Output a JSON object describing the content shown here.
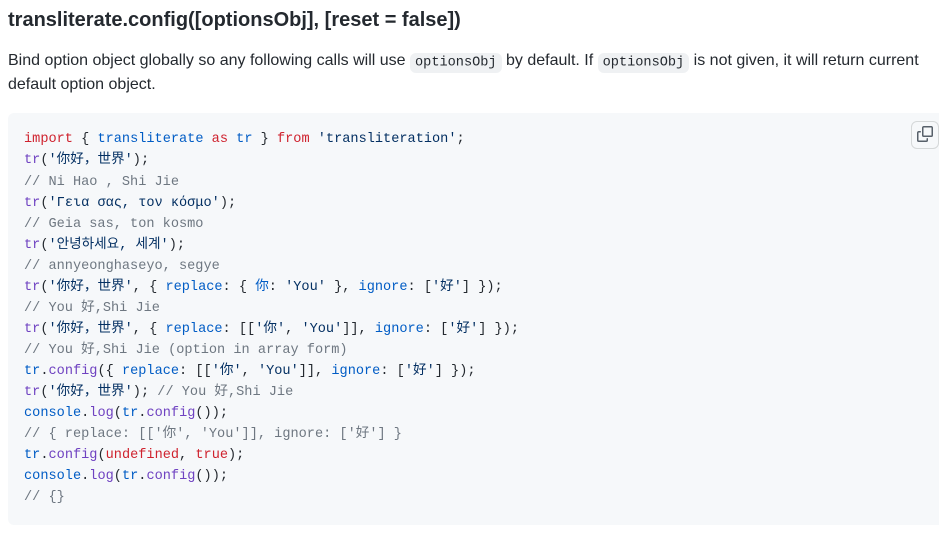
{
  "heading": "transliterate.config([optionsObj], [reset = false])",
  "desc": {
    "pre": "Bind option object globally so any following calls will use ",
    "code1": "optionsObj",
    "mid": " by default. If ",
    "code2": "optionsObj",
    "post": " is not given, it will return current default option object."
  },
  "copy_label": "Copy",
  "code": {
    "l1": {
      "a": "import",
      "b": " { ",
      "c": "transliterate",
      "d": " ",
      "e": "as",
      "f": " ",
      "g": "tr",
      "h": " } ",
      "i": "from",
      "j": " ",
      "k": "'transliteration'",
      "l": ";"
    },
    "l2": {
      "a": "tr",
      "b": "(",
      "c": "'你好，世界'",
      "d": ");"
    },
    "l3": {
      "a": "// Ni Hao , Shi Jie"
    },
    "l4": {
      "a": "tr",
      "b": "(",
      "c": "'Γεια σας, τον κόσμο'",
      "d": ");"
    },
    "l5": {
      "a": "// Geia sas, ton kosmo"
    },
    "l6": {
      "a": "tr",
      "b": "(",
      "c": "'안녕하세요, 세계'",
      "d": ");"
    },
    "l7": {
      "a": "// annyeonghaseyo, segye"
    },
    "l8": {
      "a": "tr",
      "b": "(",
      "c": "'你好，世界'",
      "d": ", { ",
      "e": "replace",
      "f": ": { ",
      "g": "你",
      "h": ": ",
      "i": "'You'",
      "j": " }, ",
      "k": "ignore",
      "l": ": [",
      "m": "'好'",
      "n": "] });"
    },
    "l9": {
      "a": "// You 好,Shi Jie"
    },
    "l10": {
      "a": "tr",
      "b": "(",
      "c": "'你好，世界'",
      "d": ", { ",
      "e": "replace",
      "f": ": [[",
      "g": "'你'",
      "h": ", ",
      "i": "'You'",
      "j": "]], ",
      "k": "ignore",
      "l": ": [",
      "m": "'好'",
      "n": "] });"
    },
    "l11": {
      "a": "// You 好,Shi Jie (option in array form)"
    },
    "l12": {
      "a": "tr",
      "b": ".",
      "c": "config",
      "d": "({ ",
      "e": "replace",
      "f": ": [[",
      "g": "'你'",
      "h": ", ",
      "i": "'You'",
      "j": "]], ",
      "k": "ignore",
      "l": ": [",
      "m": "'好'",
      "n": "] });"
    },
    "l13": {
      "a": "tr",
      "b": "(",
      "c": "'你好，世界'",
      "d": "); ",
      "e": "// You 好,Shi Jie"
    },
    "l14": {
      "a": "console",
      "b": ".",
      "c": "log",
      "d": "(",
      "e": "tr",
      "f": ".",
      "g": "config",
      "h": "());"
    },
    "l15": {
      "a": "// { replace: [['你', 'You']], ignore: ['好'] }"
    },
    "l16": {
      "a": "tr",
      "b": ".",
      "c": "config",
      "d": "(",
      "e": "undefined",
      "f": ", ",
      "g": "true",
      "h": ");"
    },
    "l17": {
      "a": "console",
      "b": ".",
      "c": "log",
      "d": "(",
      "e": "tr",
      "f": ".",
      "g": "config",
      "h": "());"
    },
    "l18": {
      "a": "// {}"
    }
  }
}
